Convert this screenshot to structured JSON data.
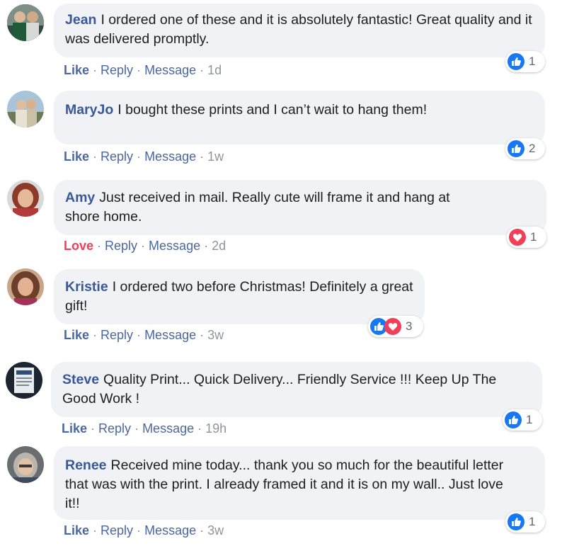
{
  "comments": [
    {
      "author": "Jean",
      "text": "I ordered one of these and it is absolutely fantastic! Great quality and it was delivered promptly.",
      "action": "Like",
      "reply": "Reply",
      "message": "Message",
      "time": "1d",
      "reaction_count": "1",
      "reactions": [
        "like"
      ]
    },
    {
      "author": "MaryJo",
      "text": "I bought these prints and I can’t wait to hang them!",
      "action": "Like",
      "reply": "Reply",
      "message": "Message",
      "time": "1w",
      "reaction_count": "2",
      "reactions": [
        "like"
      ]
    },
    {
      "author": "Amy",
      "text": "Just received in mail. Really cute will frame it and hang at shore home.",
      "action": "Love",
      "reply": "Reply",
      "message": "Message",
      "time": "2d",
      "reaction_count": "1",
      "reactions": [
        "love"
      ]
    },
    {
      "author": "Kristie",
      "text": "I ordered two before Christmas! Definitely a great gift!",
      "action": "Like",
      "reply": "Reply",
      "message": "Message",
      "time": "3w",
      "reaction_count": "3",
      "reactions": [
        "like",
        "love"
      ]
    },
    {
      "author": "Steve",
      "text": "Quality Print... Quick Delivery... Friendly Service !!! Keep Up The Good Work !",
      "action": "Like",
      "reply": "Reply",
      "message": "Message",
      "time": "19h",
      "reaction_count": "1",
      "reactions": [
        "like"
      ]
    },
    {
      "author": "Renee",
      "text": "Received mine today... thank you so much for the beautiful letter that was with the print. I already framed it and it is on my wall.. Just love it!!",
      "action": "Like",
      "reply": "Reply",
      "message": "Message",
      "time": "3w",
      "reaction_count": "1",
      "reactions": [
        "like"
      ]
    }
  ],
  "separator": "·",
  "colors": {
    "author": "#385898",
    "like": "#1877f2",
    "love": "#f33e58",
    "bubble": "#f0f2f5"
  }
}
